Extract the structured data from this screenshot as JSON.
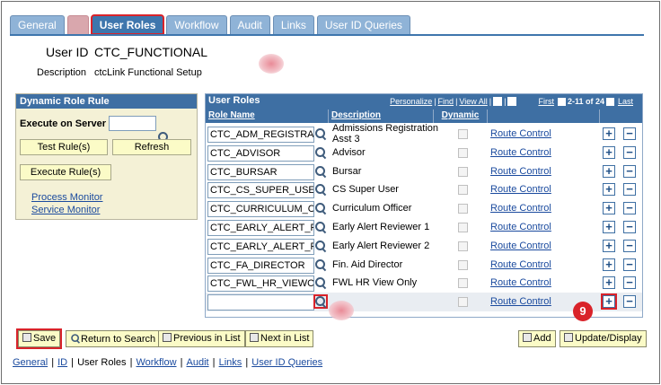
{
  "tabs": [
    {
      "label": "General",
      "active": false
    },
    {
      "label": "",
      "active": false,
      "redacted": true
    },
    {
      "label": "User Roles",
      "active": true
    },
    {
      "label": "Workflow",
      "active": false
    },
    {
      "label": "Audit",
      "active": false
    },
    {
      "label": "Links",
      "active": false
    },
    {
      "label": "User ID Queries",
      "active": false
    }
  ],
  "header": {
    "userid_label": "User ID",
    "userid_value": "CTC_FUNCTIONAL",
    "description_label": "Description",
    "description_value": "ctcLink Functional Setup"
  },
  "dynamic_role_rule": {
    "title": "Dynamic Role Rule",
    "execute_label": "Execute on Server",
    "execute_value": "",
    "test_rules_label": "Test Rule(s)",
    "refresh_label": "Refresh",
    "execute_rules_label": "Execute Rule(s)",
    "process_monitor_label": "Process Monitor",
    "service_monitor_label": "Service Monitor"
  },
  "user_roles": {
    "title": "User Roles",
    "personalize": "Personalize",
    "find": "Find",
    "view_all": "View All",
    "first": "First",
    "range": "2-11 of 24",
    "last": "Last",
    "columns": {
      "role_name": "Role Name",
      "description": "Description",
      "dynamic": "Dynamic"
    },
    "route_control_label": "Route Control",
    "add_symbol": "+",
    "delete_symbol": "−",
    "rows": [
      {
        "role": "CTC_ADM_REGISTRA",
        "desc": "Admissions Registration Asst 3"
      },
      {
        "role": "CTC_ADVISOR",
        "desc": "Advisor"
      },
      {
        "role": "CTC_BURSAR",
        "desc": "Bursar"
      },
      {
        "role": "CTC_CS_SUPER_USE",
        "desc": "CS Super User"
      },
      {
        "role": "CTC_CURRICULUM_C",
        "desc": "Curriculum Officer"
      },
      {
        "role": "CTC_EARLY_ALERT_F",
        "desc": "Early Alert Reviewer 1"
      },
      {
        "role": "CTC_EARLY_ALERT_F",
        "desc": "Early Alert Reviewer 2"
      },
      {
        "role": "CTC_FA_DIRECTOR",
        "desc": "Fin. Aid Director"
      },
      {
        "role": "CTC_FWL_HR_VIEWO",
        "desc": "FWL HR View Only"
      },
      {
        "role": "",
        "desc": ""
      }
    ]
  },
  "callout_number": "9",
  "toolbar": {
    "save": "Save",
    "return_to_search": "Return to Search",
    "previous_in_list": "Previous in List",
    "next_in_list": "Next in List",
    "add": "Add",
    "update_display": "Update/Display"
  },
  "bottom_links": [
    "General",
    "ID",
    "User Roles",
    "Workflow",
    "Audit",
    "Links",
    "User ID Queries"
  ],
  "colors": {
    "header_blue": "#3e6fa3",
    "tab_blue": "#8fb3d7",
    "highlight_red": "#d9232a",
    "panel_yellow": "#f4f1d6"
  }
}
